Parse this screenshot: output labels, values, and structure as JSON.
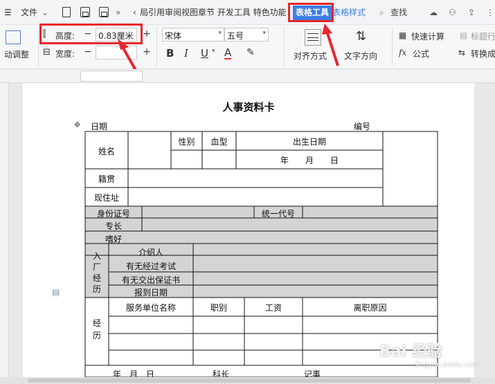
{
  "menubar": {
    "file_label": "文件",
    "tabs_text": "局引用审阅视图章节 开发工具 特色功能",
    "active_tab": "表格工具",
    "next_tab": "表格样式",
    "search_label": "查找"
  },
  "ribbon": {
    "auto_adjust_label": "动调整",
    "height_label": "高度:",
    "height_value": "0.83厘米",
    "width_label": "宽度:",
    "width_value": "",
    "font_name": "宋体",
    "font_size": "五号",
    "bold": "B",
    "italic": "I",
    "underline": "U",
    "font_color": "A",
    "align_label": "对齐方式",
    "text_dir_label": "文字方向",
    "quick_calc_label": "快速计算",
    "title_row_label": "标题行",
    "formula_label": "公式",
    "convert_label": "转换成"
  },
  "document": {
    "title": "人事资料卡",
    "date_label": "日期",
    "number_label": "编号",
    "name": "姓名",
    "gender": "性别",
    "blood_type": "血型",
    "birth_date": "出生日期",
    "ymd": "年　　月　　日",
    "native_place": "籍贯",
    "address": "现住址",
    "id_number": "身份证号",
    "unified_code": "统一代号",
    "specialty": "专长",
    "hobby": "嗜好",
    "entry_exp": "入\n厂\n经\n历",
    "introducer": "介绍人",
    "exam": "有无经过考试",
    "guarantee": "有无交出保证书",
    "report_date": "报到日期",
    "exp": "经\n历",
    "company": "服务单位名称",
    "position": "职别",
    "salary": "工资",
    "reason": "离职原因",
    "bottom_row": "年　月　日　　　　　　　科长　　　　　　　　　记事"
  },
  "watermark": {
    "main": "Bai 经验",
    "sub": "jingyan.baidu.com"
  }
}
